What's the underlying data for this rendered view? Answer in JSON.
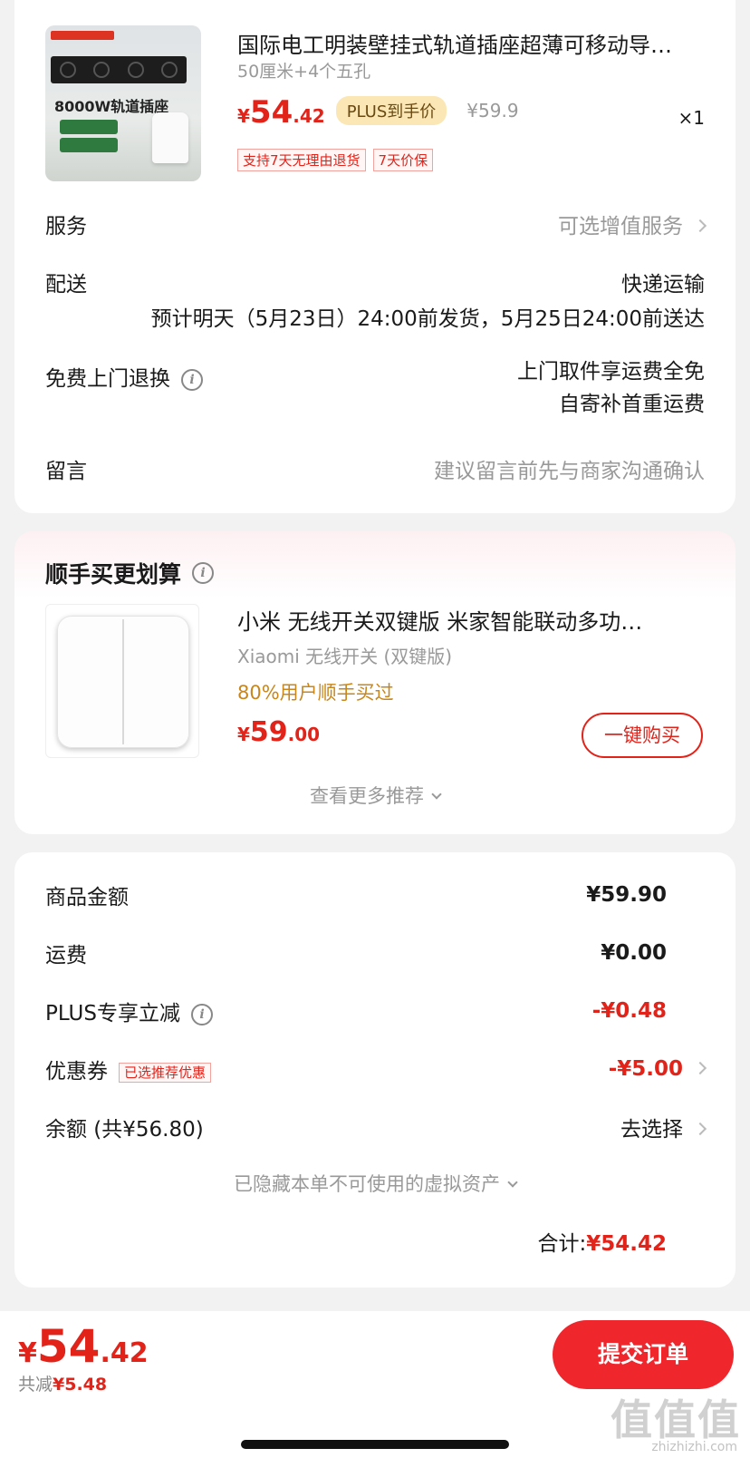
{
  "product": {
    "title": "国际电工明装壁挂式轨道插座超薄可移动导…",
    "spec": "50厘米+4个五孔",
    "price_yen": "¥",
    "price_int": "54",
    "price_dec": ".42",
    "plus_tag": "PLUS到手价",
    "original_price": "¥59.9",
    "quantity": "×1",
    "tags": [
      "支持7天无理由退货",
      "7天价保"
    ],
    "thumb_text": "8000W轨道插座"
  },
  "order_options": {
    "service_label": "服务",
    "service_value": "可选增值服务",
    "delivery_label": "配送",
    "delivery_method": "快递运输",
    "delivery_estimate": "预计明天（5月23日）24:00前发货，5月25日24:00前送达",
    "return_label": "免费上门退换",
    "return_line1": "上门取件享运费全免",
    "return_line2": "自寄补首重运费",
    "message_label": "留言",
    "message_placeholder": "建议留言前先与商家沟通确认"
  },
  "buy_more": {
    "heading": "顺手买更划算",
    "title": "小米 无线开关双键版 米家智能联动多功…",
    "subtitle": "Xiaomi 无线开关 (双键版)",
    "percent_text": "80%用户顺手买过",
    "price_yen": "¥",
    "price_int": "59",
    "price_dec": ".00",
    "buy_button": "一键购买",
    "see_more": "查看更多推荐"
  },
  "summary": {
    "goods_label": "商品金额",
    "goods_value": "¥59.90",
    "shipping_label": "运费",
    "shipping_value": "¥0.00",
    "plus_label": "PLUS专享立减",
    "plus_value": "-¥0.48",
    "coupon_label": "优惠券",
    "coupon_tag": "已选推荐优惠",
    "coupon_value": "-¥5.00",
    "balance_label": "余额 (共¥56.80)",
    "balance_value": "去选择",
    "hidden_assets": "已隐藏本单不可使用的虚拟资产",
    "total_label": "合计:",
    "total_value": "¥54.42"
  },
  "bottom_bar": {
    "price_yen": "¥",
    "price_int": "54",
    "price_dec": ".42",
    "saved_label": "共减",
    "saved_value": "¥5.48",
    "submit_button": "提交订单"
  },
  "watermark": {
    "text": "值值值",
    "url": "zhizhizhi.com"
  },
  "colors": {
    "accent_red": "#e2231a",
    "submit_red": "#f0262d",
    "plus_gold": "#fbe7b5",
    "percent_orange": "#c9861a"
  }
}
